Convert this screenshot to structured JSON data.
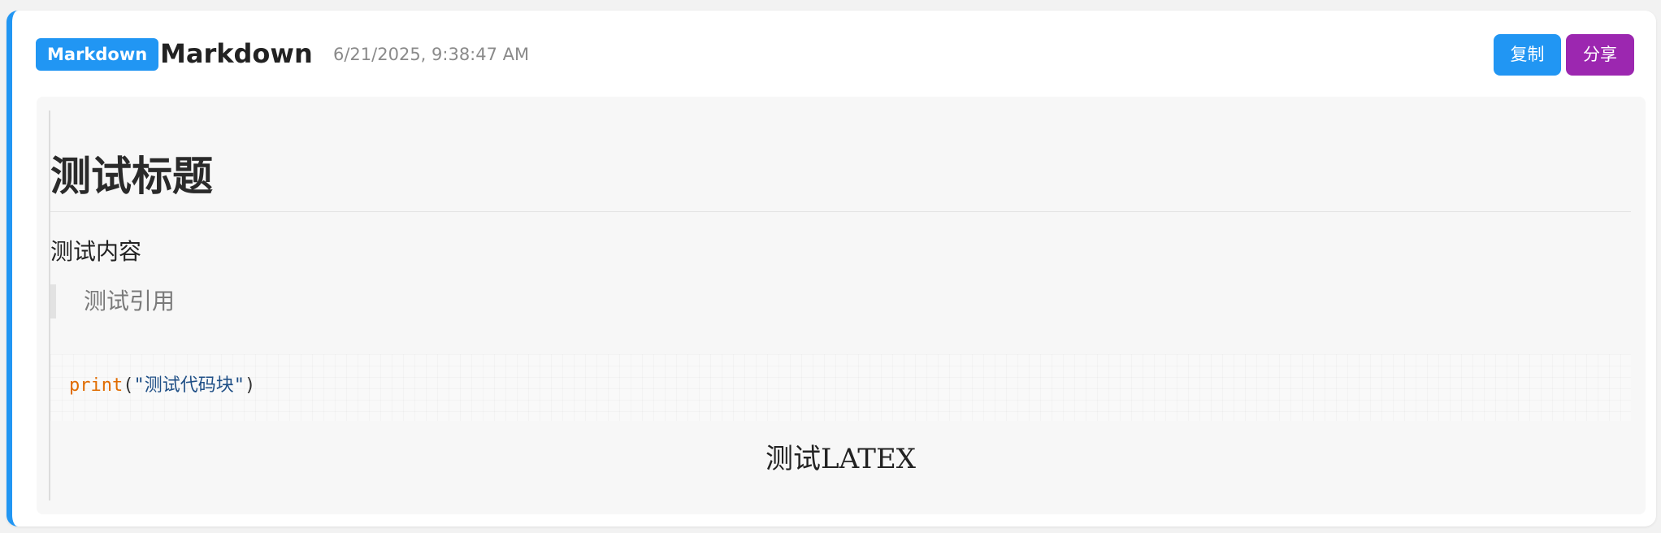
{
  "header": {
    "badge": "Markdown",
    "title": "Markdown",
    "timestamp": "6/21/2025, 9:38:47 AM",
    "copy_label": "复制",
    "share_label": "分享"
  },
  "content": {
    "heading": "测试标题",
    "paragraph": "测试内容",
    "blockquote": "测试引用",
    "code": {
      "function": "print",
      "open_paren": "(",
      "string": "\"测试代码块\"",
      "close_paren": ")"
    },
    "latex": "测试LATEX"
  },
  "colors": {
    "accent": "#2196f3",
    "share": "#9c27b0",
    "code_function": "#e06c00",
    "code_string": "#1f4f86"
  }
}
